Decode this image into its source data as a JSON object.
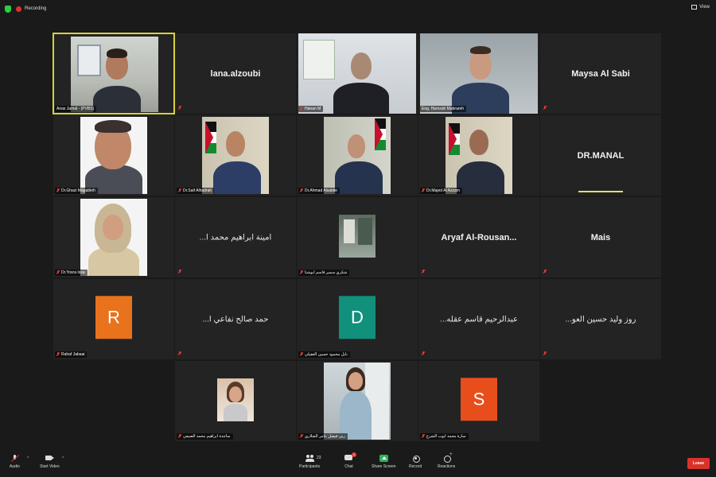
{
  "topbar": {
    "recording_label": "Recording",
    "view_label": "View"
  },
  "tiles": [
    {
      "id": "t1",
      "label": "Anas Jamal - (PVBS)",
      "type": "video"
    },
    {
      "id": "t2",
      "display_name": "lana.alzoubi",
      "type": "name"
    },
    {
      "id": "t3",
      "label": "Hanan M",
      "type": "video"
    },
    {
      "id": "t4",
      "label": "Eng. Hamzah Mabrareh",
      "type": "video"
    },
    {
      "id": "t5",
      "display_name": "Maysa Al Sabi",
      "type": "name"
    },
    {
      "id": "t6",
      "label": "Dr.Ghazi Magableh",
      "type": "video"
    },
    {
      "id": "t7",
      "label": "Dr.Saif Alhadrah",
      "type": "video"
    },
    {
      "id": "t8",
      "label": "Dr.Ahmad Alsabile",
      "type": "video"
    },
    {
      "id": "t9",
      "label": "Dr.Majed Al Azzam",
      "type": "video"
    },
    {
      "id": "t10",
      "display_name": "DR.MANAL",
      "type": "name"
    },
    {
      "id": "t11",
      "label": "Dr.Yosra Issa",
      "type": "video"
    },
    {
      "id": "t12",
      "display_name": "...امينة ابراهيم محمد ا",
      "type": "name"
    },
    {
      "id": "t13",
      "label": "شكري سمير قاسم ابوشتا",
      "type": "photo"
    },
    {
      "id": "t14",
      "display_name": "Aryaf Al-Rousan...",
      "type": "name"
    },
    {
      "id": "t15",
      "display_name": "Mais",
      "type": "name"
    },
    {
      "id": "t16",
      "label": "Rahaf Jabaai",
      "letter": "R",
      "color": "#e8731c",
      "type": "avatar"
    },
    {
      "id": "t17",
      "display_name": "...حمد صالح نفاعي ا",
      "type": "name"
    },
    {
      "id": "t18",
      "label": "نايل محمود حسين العقيلي",
      "letter": "D",
      "color": "#11907c",
      "type": "avatar"
    },
    {
      "id": "t19",
      "display_name": "...عبدالرحيم قاسم عقله",
      "type": "name"
    },
    {
      "id": "t20",
      "display_name": "...روز وليد حسين العو",
      "type": "name"
    },
    {
      "id": "t21",
      "label": "ساجدة ابراهيم محمد الصيفي",
      "type": "photo"
    },
    {
      "id": "t22",
      "label": "ربى فيصل عامر الشلاري",
      "type": "photo"
    },
    {
      "id": "t23",
      "label": "سارة محمد ايوب الشرع",
      "letter": "S",
      "color": "#e84e1c",
      "type": "avatar"
    }
  ],
  "toolbar": {
    "audio_label": "Audio",
    "video_label": "Start Video",
    "participants_label": "Participants",
    "participants_count": "23",
    "chat_label": "Chat",
    "chat_badge": "1",
    "share_label": "Share Screen",
    "record_label": "Record",
    "reactions_label": "Reactions",
    "leave_label": "Leave"
  }
}
